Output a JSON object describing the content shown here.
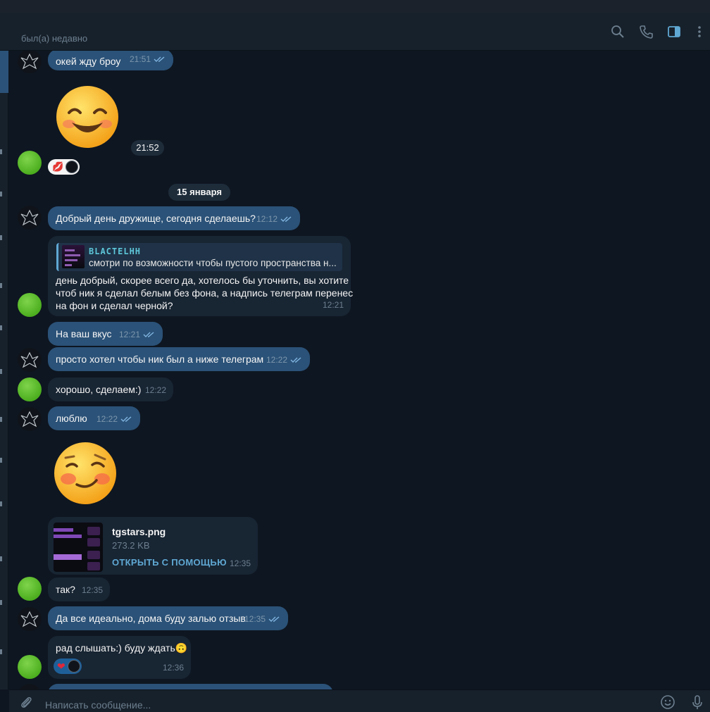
{
  "header": {
    "status": "был(а) недавно",
    "icons": [
      "search-icon",
      "phone-icon",
      "sidebar-panel-icon",
      "more-vertical-icon"
    ],
    "accent": "#5fa8d3"
  },
  "chat": {
    "date_divider": "15 января",
    "sticker1_time": "21:52",
    "messages": [
      {
        "text": "окей жду броу",
        "time": "21:51",
        "dir": "out"
      },
      {
        "text": "Добрый день дружище, сегодня сделаешь?",
        "time": "12:12",
        "dir": "out"
      },
      {
        "reply_name": "BLACTELHH",
        "reply_text": "смотри по возможности чтобы пустого пространства н...",
        "line1": "день добрый, скорее всего да, хотелось бы уточнить, вы хотите",
        "line2": "чтоб ник я сделал белым без фона, а надпись телеграм перенес",
        "line3": "на фон и сделал черной?",
        "time": "12:21",
        "dir": "in"
      },
      {
        "text": "На ваш вкус",
        "time": "12:21",
        "dir": "out"
      },
      {
        "text": "просто хотел чтобы ник был а ниже телеграм",
        "time": "12:22",
        "dir": "out"
      },
      {
        "text": "хорошо, сделаем:)",
        "time": "12:22",
        "dir": "in"
      },
      {
        "text": "люблю",
        "time": "12:22",
        "dir": "out"
      },
      {
        "file_name": "tgstars.png",
        "file_size": "273.2 KB",
        "file_action": "ОТКРЫТЬ С ПОМОЩЬЮ",
        "time": "12:35",
        "dir": "in"
      },
      {
        "text": "так?",
        "time": "12:35",
        "dir": "in"
      },
      {
        "text": "Да все идеально, дома буду залью отзыв",
        "time": "12:35",
        "dir": "out"
      },
      {
        "text": "рад слышать:) буду ждать🙃",
        "time": "12:36",
        "dir": "in"
      }
    ],
    "reactions": {
      "kiss": "💋",
      "heart": "❤"
    }
  },
  "composer": {
    "placeholder": "Написать сообщение...",
    "icons": [
      "paperclip-icon",
      "emoji-icon",
      "microphone-icon"
    ]
  }
}
